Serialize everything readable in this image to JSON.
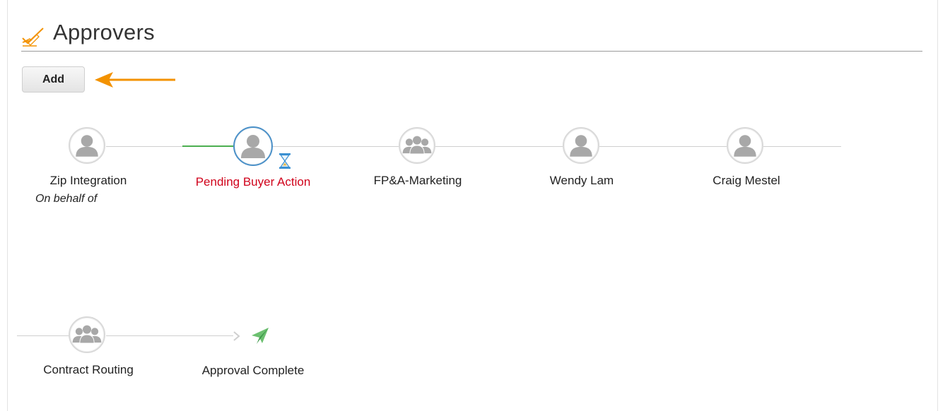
{
  "section": {
    "title": "Approvers",
    "icon": "approval-check-icon"
  },
  "toolbar": {
    "add_label": "Add",
    "arrow_icon": "arrow-left-icon",
    "arrow_color": "#f39200"
  },
  "workflow": {
    "row1": [
      {
        "name": "Zip Integration",
        "sub": "On behalf of",
        "icon": "user-icon"
      },
      {
        "name": "Pending Buyer Action",
        "status": "pending",
        "icon": "user-icon",
        "badge": "hourglass-icon"
      },
      {
        "name": "FP&A-Marketing",
        "icon": "group-icon"
      },
      {
        "name": "Wendy Lam",
        "icon": "user-icon"
      },
      {
        "name": "Craig Mestel",
        "icon": "user-icon"
      }
    ],
    "row2": [
      {
        "name": "Contract Routing",
        "icon": "group-icon"
      },
      {
        "name": "Approval Complete",
        "icon": "paper-plane-icon"
      }
    ]
  },
  "colors": {
    "pending_text": "#d0021b",
    "active_ring": "#4a90c8",
    "progress_line": "#4caf50",
    "accent_orange": "#f39200",
    "complete_green": "#4caf50"
  }
}
